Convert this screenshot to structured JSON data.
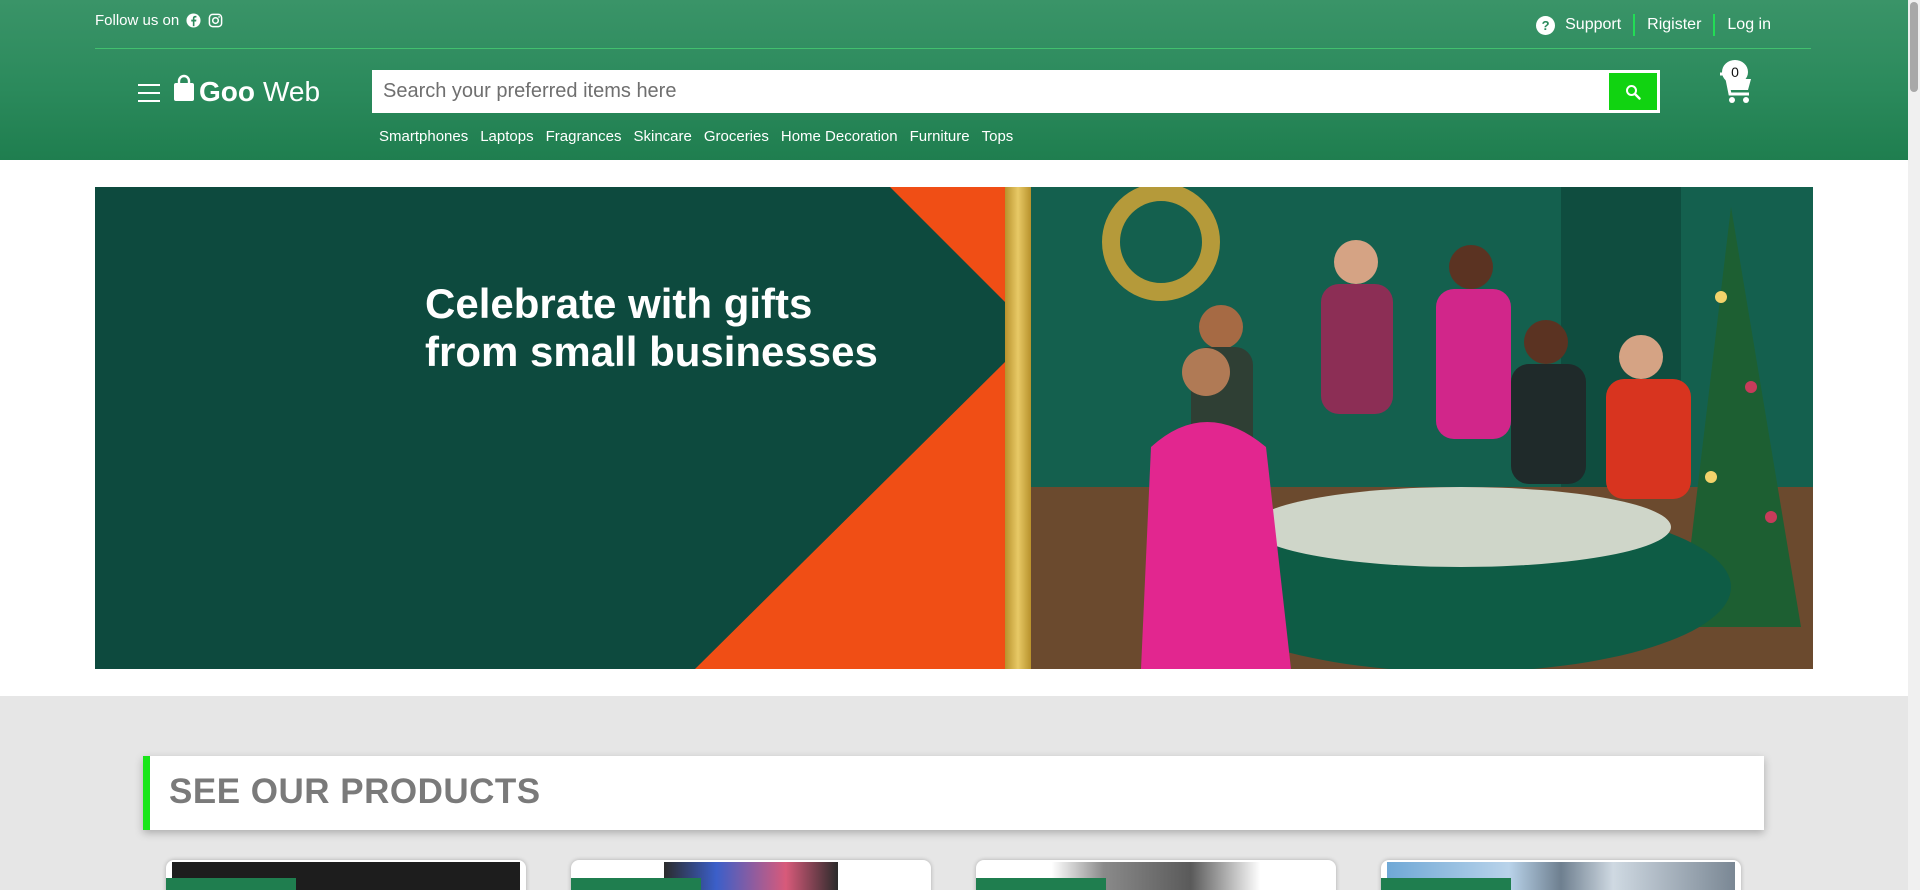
{
  "header": {
    "follow_label": "Follow us on",
    "social_icons": [
      "facebook-icon",
      "instagram-icon"
    ],
    "links": {
      "support": "Support",
      "register": "Rigister",
      "login": "Log in"
    },
    "help_glyph": "?",
    "logo": {
      "bold": "Goo",
      "regular": "Web"
    },
    "cart_count": "0",
    "colors": {
      "header_green": "#2b8a5c",
      "accent_green": "#11d311"
    }
  },
  "search": {
    "placeholder": "Search your preferred items here",
    "value": ""
  },
  "categories": [
    "Smartphones",
    "Laptops",
    "Fragrances",
    "Skincare",
    "Groceries",
    "Home Decoration",
    "Furniture",
    "Tops"
  ],
  "banner": {
    "title_line1": "Celebrate with gifts",
    "title_line2": "from small businesses",
    "colors": {
      "dark": "#0d4a3e",
      "orange": "#f04e15"
    }
  },
  "products_section": {
    "title": "SEE OUR PRODUCTS"
  }
}
